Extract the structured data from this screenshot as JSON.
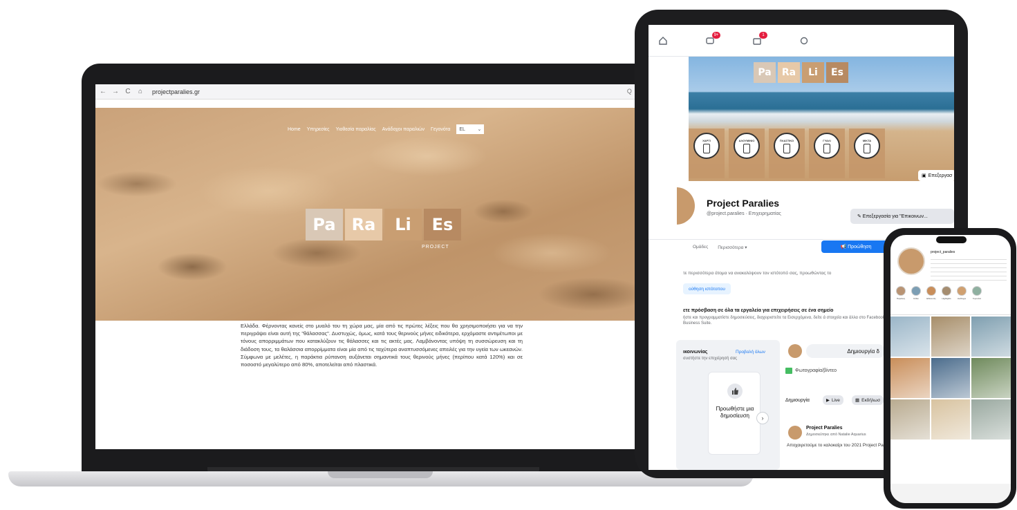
{
  "laptop": {
    "browser": {
      "url": "projectparalies.gr",
      "nav_glyphs": [
        "←",
        "→",
        "C",
        "⌂"
      ],
      "lock_glyph": "🔒",
      "right_glyphs": [
        "Q",
        "⊞",
        "☆",
        ":"
      ]
    },
    "nav": {
      "items": [
        "Home",
        "Υπηρεσίες",
        "Υιοθεσία παραλίας",
        "Ανάδοχοι παραλιών",
        "Γεγονότα"
      ],
      "language": "EL",
      "language_caret": "⌄"
    },
    "logo": {
      "tiles": [
        "Pa",
        "Ra",
        "Li",
        "Es"
      ],
      "tile_colors": [
        "#d9c8b6",
        "#e7c9a8",
        "#c99e72",
        "#b78a62"
      ],
      "subtitle": "PROJECT"
    },
    "article_text": "Ελλάδα. Φέρνοντας κανείς στο μυαλό του τη χώρα μας, μία από τις πρώτες λέξεις που θα χρησιμοποιήσει για να την περιγράψει είναι αυτή της \"θάλασσας\". Δυστυχώς, όμως, κατά τους θερινούς μήνες ειδικότερα, ερχόμαστε αντιμέτωποι με τόνους απορριμμάτων που κατακλύζουν τις θάλασσες και τις ακτές μας. Λαμβάνοντας υπόψη τη συσσώρευση και τη διάδοση τους, τα θαλάσσια απορρίμματα είναι μία από τις ταχύτερα αναπτυσσόμενες απειλές για την υγεία των ωκεανών. Σύμφωνα με μελέτες, η παράκτια ρύπανση αυξάνεται σημαντικά τους θερινούς μήνες (περίπου κατά 120%) και σε ποσοστό μεγαλύτερο από 80%, αποτελείται από πλαστικά.",
    "chat_icon": "chat-icon",
    "accent": "#2f5ee0"
  },
  "tablet": {
    "top_badges": [
      "9+",
      "1"
    ],
    "cover_logo": [
      "Pa",
      "Ra",
      "Li",
      "Es"
    ],
    "bins": [
      "ΧΑΡΤΙ",
      "ΑΛΟΥΜΙΝΙΟ",
      "ΠΛΑΣΤΙΚΟ",
      "ΓΥΑΛΙ",
      "ΜΙΚΤΑ"
    ],
    "edit_cover": "Επεξεργασ",
    "page_name": "Project Paralies",
    "page_handle": "@project.paralies · Επιχειρηματίας",
    "edit_contact": "✎ Επεξεργασία για \"Επικοινων...",
    "tabs": [
      "Ομάδες",
      "Περισσότερα ▾"
    ],
    "promote_button": "📢 Προώθηση",
    "promo_info": "τε περισσότερα άτομα να ανακαλύψουν τον ιστότοπό σας, προωθώντας το",
    "promote_site": "ούθηση ιστότοπου",
    "tools_title": "ετε πρόσβαση σε όλα τα εργαλεία για επιχειρήσεις σε ένα σημείο",
    "tools_desc": "ήστε και προγραμματίστε δημοσιεύσεις, διαχειριστείτε τα Εισερχόμενα, δείτε ά στοιχεία και άλλα στο Facebook Business Suite.",
    "contact_title": "ικοινωνίας",
    "contact_link": "Προβολή όλων",
    "contact_sub": "συστήστε την επιχείρησή σας",
    "promo_post_label": "Προωθήστε μια δημοσίευση",
    "carousel_arrow": "›",
    "create_post_button": "Δημιουργία δ",
    "photo_video": "Φωτογραφία/βίντεο",
    "create_label": "Δημιουργία",
    "live_label": "Live",
    "event_label": "Εκδήλωσ",
    "post_author": "Project Paralies",
    "post_meta": "Δημοσιεύτηκε από Natalie Aquarius",
    "post_text": "Αποχαιρετούμε το καλοκαίρι του 2021 Project PaRaLiEs! Πολλή δουλειά με εξ",
    "accent": "#1877f2"
  },
  "phone": {
    "username": "project_paralies",
    "highlights": [
      "Παραλίες",
      "Κάδοι",
      "Εθελοντές",
      "Highlights",
      "Ανάδοχοι",
      "Γεγονότα"
    ],
    "grid_colors": [
      "#9bb6c8",
      "#a78e6a",
      "#7f9fb0",
      "#c98e5a",
      "#4b6c8c",
      "#6f8a5c",
      "#b9ab90",
      "#d8c3a0",
      "#9aa9a0"
    ]
  }
}
